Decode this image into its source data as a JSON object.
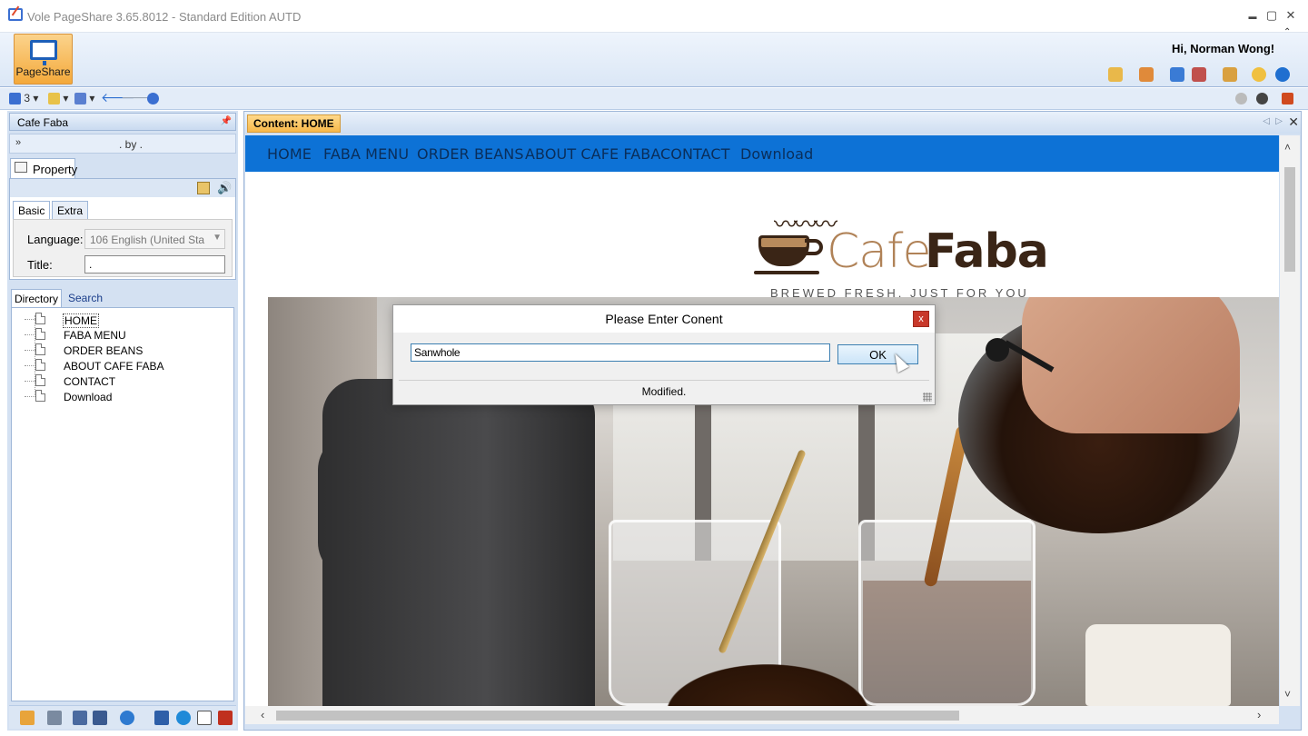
{
  "window": {
    "title": "Vole PageShare  3.65.8012 - Standard Edition AUTD",
    "min": "▬",
    "max": "▢",
    "close": "✕"
  },
  "ribbon": {
    "pageshare_label": "PageShare",
    "greeting": "Hi, Norman Wong!",
    "collapse": "⌃",
    "icons": [
      "paint-brush-icon",
      "rocket-icon",
      "browser-icon",
      "shield-ribbon-icon",
      "tools-icon",
      "stopwatch-icon",
      "info-icon"
    ]
  },
  "toolbar": {
    "count": "3",
    "dropdown": "▾",
    "back": "🡐",
    "forward": "🡒"
  },
  "left_panel": {
    "header": "Cafe Faba",
    "pin": "📌",
    "expand": "»",
    "by_text": ". by .",
    "property_tab": "Property",
    "sub_tabs": [
      "Basic",
      "Extra"
    ],
    "language_label": "Language:",
    "language_value": "106 English (United Sta",
    "title_label": "Title:",
    "title_value": ".",
    "dir_tabs": [
      "Directory",
      "Search"
    ],
    "tree": [
      "HOME",
      "FABA MENU",
      "ORDER BEANS",
      "ABOUT CAFE FABA",
      "CONTACT",
      "Download"
    ],
    "bottom_icons": [
      "home-icon",
      "xml-icon",
      "vmc-icon",
      "doc-icon",
      "eye-icon",
      "word-icon",
      "globe-icon",
      "page-icon",
      "text-icon"
    ]
  },
  "content": {
    "tab_label": "Content: HOME",
    "close": "✕"
  },
  "website": {
    "nav": [
      "HOME",
      "FABA MENU",
      "ORDER BEANS",
      "ABOUT CAFE FABA",
      "CONTACT",
      "Download"
    ],
    "logo_light": "Cafe",
    "logo_bold": "Faba",
    "tagline": "BREWED FRESH, JUST FOR YOU",
    "steam": "〰〰〰"
  },
  "dialog": {
    "title": "Please Enter Conent",
    "close": "x",
    "input_value": "Sanwhole",
    "ok_label": "OK",
    "status": "Modified."
  },
  "colors": {
    "accent_orange": "#f7b84a",
    "site_nav_blue": "#0d72d6",
    "dialog_close_red": "#c8392b"
  }
}
